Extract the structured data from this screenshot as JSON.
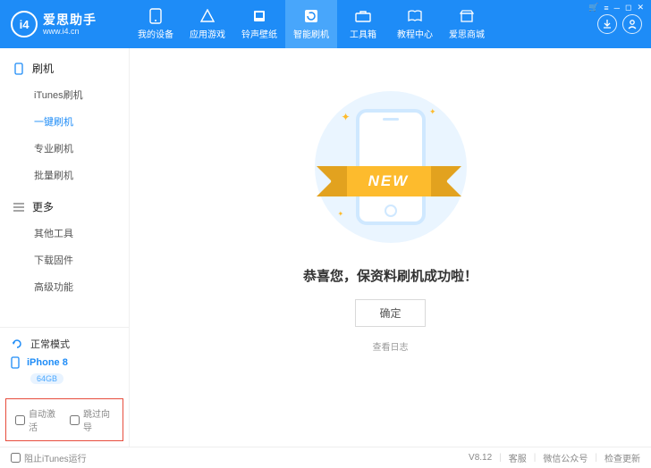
{
  "brand": {
    "logo_text": "i4",
    "name": "爱思助手",
    "url": "www.i4.cn"
  },
  "nav": {
    "items": [
      {
        "label": "我的设备",
        "icon": "device"
      },
      {
        "label": "应用游戏",
        "icon": "apps"
      },
      {
        "label": "铃声壁纸",
        "icon": "music"
      },
      {
        "label": "智能刷机",
        "icon": "refresh",
        "active": true
      },
      {
        "label": "工具箱",
        "icon": "toolbox"
      },
      {
        "label": "教程中心",
        "icon": "book"
      },
      {
        "label": "爱思商城",
        "icon": "shop"
      }
    ]
  },
  "sidebar": {
    "groups": [
      {
        "title": "刷机",
        "icon": "phone-icon",
        "items": [
          {
            "label": "iTunes刷机"
          },
          {
            "label": "一键刷机",
            "active": true
          },
          {
            "label": "专业刷机"
          },
          {
            "label": "批量刷机"
          }
        ]
      },
      {
        "title": "更多",
        "icon": "list-icon",
        "items": [
          {
            "label": "其他工具"
          },
          {
            "label": "下载固件"
          },
          {
            "label": "高级功能"
          }
        ]
      }
    ],
    "mode": {
      "label": "正常模式"
    },
    "device": {
      "name": "iPhone 8",
      "storage": "64GB"
    },
    "checks": {
      "auto_activate": "自动激活",
      "skip_wizard": "跳过向导"
    }
  },
  "main": {
    "ribbon": "NEW",
    "message": "恭喜您，保资料刷机成功啦！",
    "ok": "确定",
    "view_log": "查看日志"
  },
  "footer": {
    "block_itunes": "阻止iTunes运行",
    "version": "V8.12",
    "support": "客服",
    "wechat": "微信公众号",
    "update": "检查更新"
  }
}
